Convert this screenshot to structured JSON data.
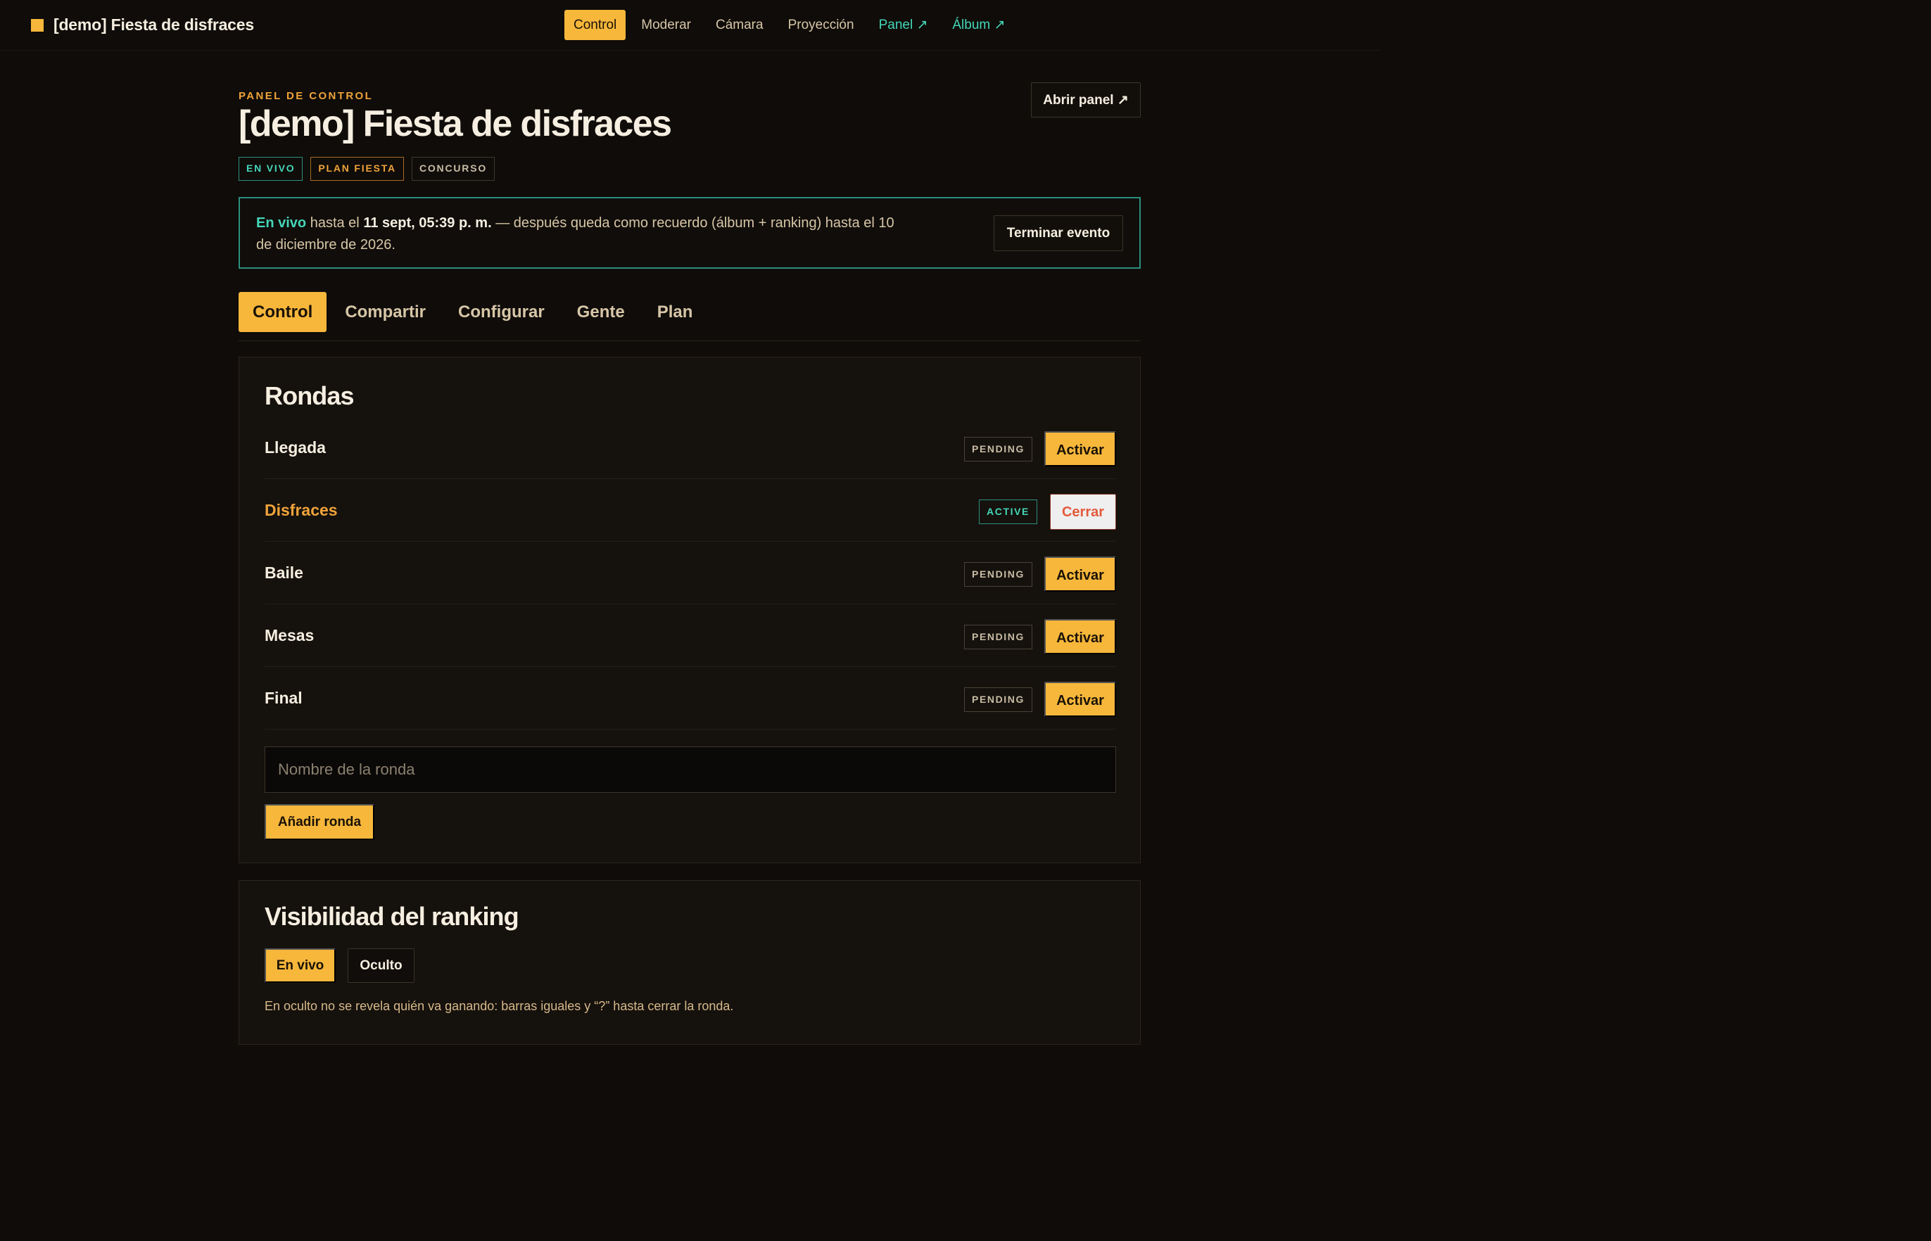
{
  "brand": {
    "name": "[demo] Fiesta de disfraces"
  },
  "nav": {
    "control": "Control",
    "moderate": "Moderar",
    "camera": "Cámara",
    "projection": "Proyección",
    "panel": "Panel ↗",
    "album": "Álbum ↗"
  },
  "header": {
    "kicker": "PANEL DE CONTROL",
    "title": "[demo] Fiesta de disfraces",
    "open_panel": "Abrir panel ↗",
    "badges": {
      "live": "EN VIVO",
      "plan": "PLAN FIESTA",
      "contest": "CONCURSO"
    }
  },
  "notice": {
    "live": "En vivo",
    "until": " hasta el ",
    "date": "11 sept, 05:39 p. m.",
    "rest": " — después queda como recuerdo (álbum + ranking) hasta el 10 de diciembre de 2026.",
    "end_button": "Terminar evento"
  },
  "tabs": [
    "Control",
    "Compartir",
    "Configurar",
    "Gente",
    "Plan"
  ],
  "rounds": {
    "title": "Rondas",
    "items": [
      {
        "name": "Llegada",
        "status": "PENDING",
        "action": "Activar"
      },
      {
        "name": "Disfraces",
        "status": "ACTIVE",
        "action": "Cerrar"
      },
      {
        "name": "Baile",
        "status": "PENDING",
        "action": "Activar"
      },
      {
        "name": "Mesas",
        "status": "PENDING",
        "action": "Activar"
      },
      {
        "name": "Final",
        "status": "PENDING",
        "action": "Activar"
      }
    ],
    "input_placeholder": "Nombre de la ronda",
    "add_button": "Añadir ronda"
  },
  "visibility": {
    "title": "Visibilidad del ranking",
    "live": "En vivo",
    "hidden": "Oculto",
    "note": "En oculto no se revela quién va ganando: barras iguales y “?” hasta cerrar la ronda."
  },
  "colors": {
    "accent": "#f7b73b",
    "live": "#45d6b8",
    "danger": "#e35a3c",
    "background": "#0f0c09"
  }
}
